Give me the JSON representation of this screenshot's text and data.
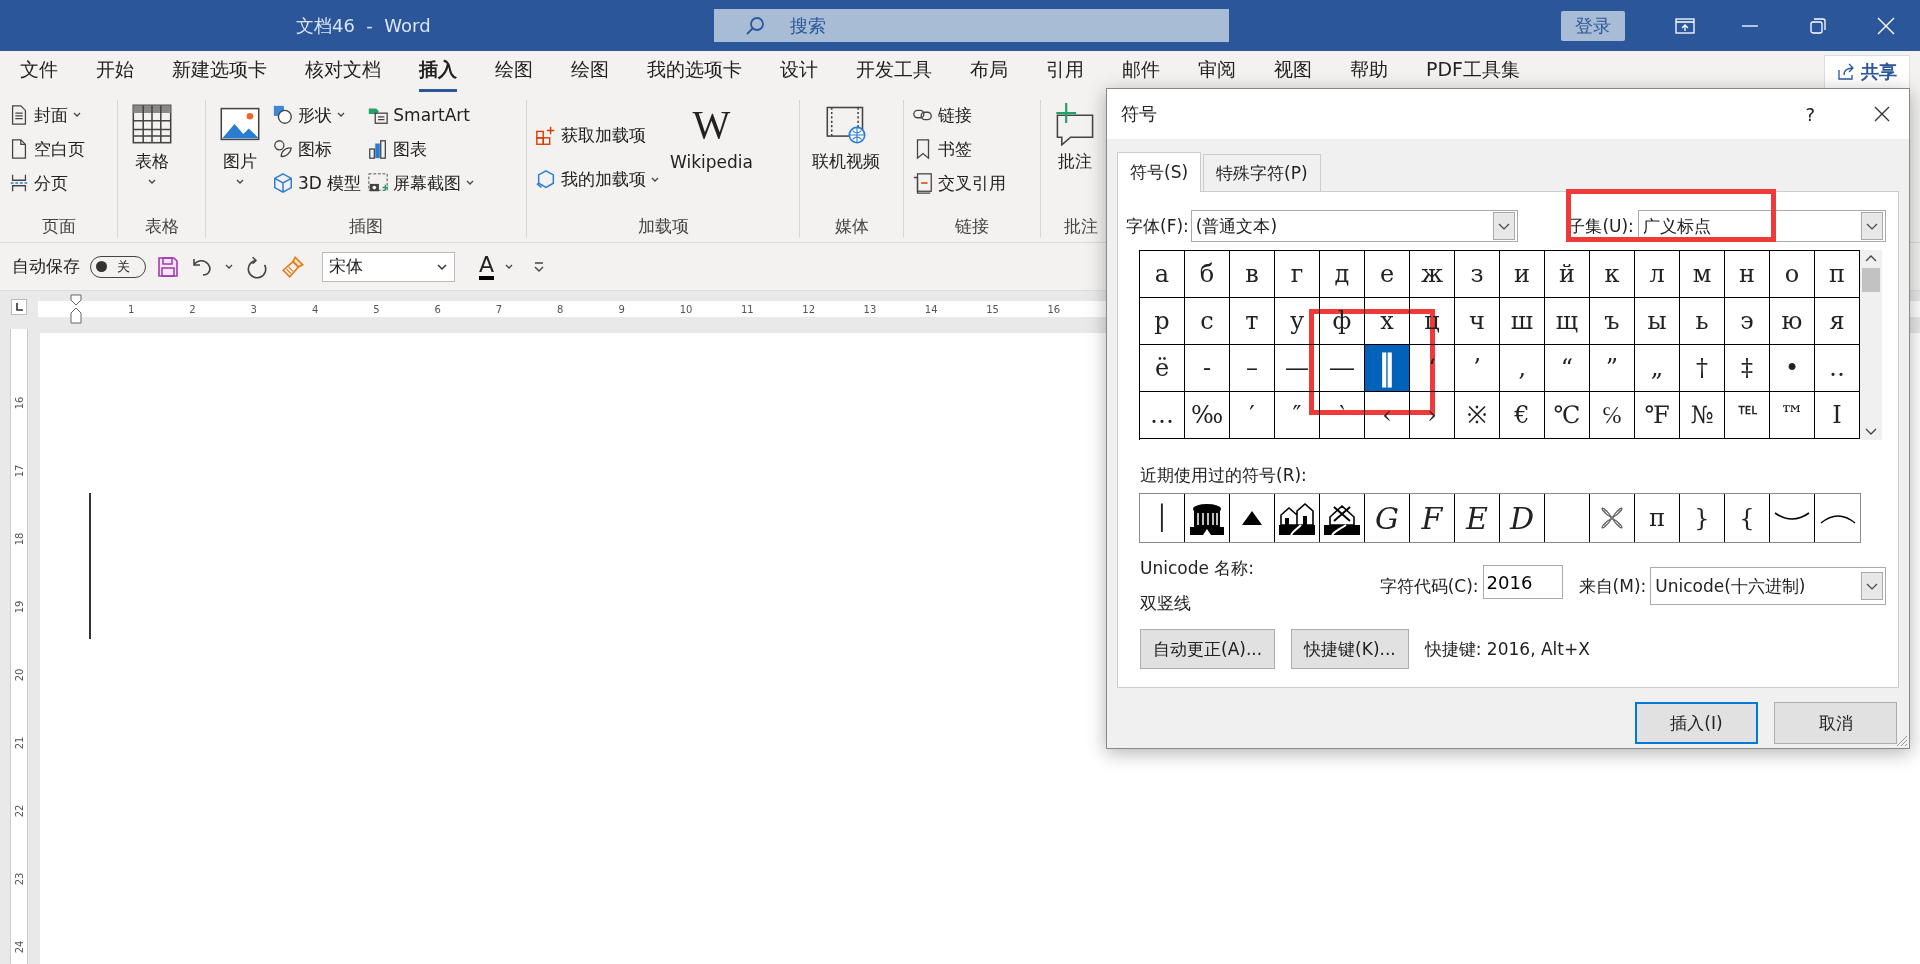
{
  "window": {
    "title": "文档46  -  Word",
    "search_placeholder": "搜索",
    "sign_in": "登录"
  },
  "menu_tabs": [
    {
      "label": "文件",
      "selected": false
    },
    {
      "label": "开始",
      "selected": false
    },
    {
      "label": "新建选项卡",
      "selected": false
    },
    {
      "label": "核对文档",
      "selected": false
    },
    {
      "label": "插入",
      "selected": true
    },
    {
      "label": "绘图",
      "selected": false
    },
    {
      "label": "绘图",
      "selected": false
    },
    {
      "label": "我的选项卡",
      "selected": false
    },
    {
      "label": "设计",
      "selected": false
    },
    {
      "label": "开发工具",
      "selected": false
    },
    {
      "label": "布局",
      "selected": false
    },
    {
      "label": "引用",
      "selected": false
    },
    {
      "label": "邮件",
      "selected": false
    },
    {
      "label": "审阅",
      "selected": false
    },
    {
      "label": "视图",
      "selected": false
    },
    {
      "label": "帮助",
      "selected": false
    },
    {
      "label": "PDF工具集",
      "selected": false
    }
  ],
  "share": "共享",
  "ribbon": {
    "groups": [
      {
        "label": "页面",
        "items": [
          {
            "label": "封面",
            "dropdown": true
          },
          {
            "label": "空白页",
            "dropdown": false
          },
          {
            "label": "分页",
            "dropdown": false
          }
        ]
      },
      {
        "label": "表格",
        "items": [
          {
            "label": "表格",
            "dropdown": true
          }
        ]
      },
      {
        "label": "插图",
        "items": [
          {
            "label": "图片",
            "dropdown": true
          },
          {
            "label": "形状",
            "dropdown": true
          },
          {
            "label": "图标",
            "dropdown": false
          },
          {
            "label": "3D 模型",
            "dropdown": false
          },
          {
            "label": "SmartArt",
            "dropdown": false
          },
          {
            "label": "图表",
            "dropdown": false
          },
          {
            "label": "屏幕截图",
            "dropdown": true
          }
        ]
      },
      {
        "label": "加载项",
        "items": [
          {
            "label": "获取加载项",
            "dropdown": false
          },
          {
            "label": "我的加载项",
            "dropdown": true
          },
          {
            "label": "Wikipedia",
            "dropdown": false,
            "logo_letter": "W"
          }
        ]
      },
      {
        "label": "媒体",
        "items": [
          {
            "label": "联机视频",
            "dropdown": false
          }
        ]
      },
      {
        "label": "链接",
        "items": [
          {
            "label": "链接",
            "dropdown": false
          },
          {
            "label": "书签",
            "dropdown": false
          },
          {
            "label": "交叉引用",
            "dropdown": false
          }
        ]
      },
      {
        "label": "批注",
        "items": [
          {
            "label": "批注",
            "dropdown": false
          }
        ]
      }
    ]
  },
  "quick_access": {
    "autosave_label": "自动保存",
    "autosave_on": false,
    "autosave_state": "关",
    "font": "宋体",
    "font_color_letter": "A"
  },
  "ruler": {
    "numbers": [
      "1",
      "2",
      "3",
      "4",
      "5",
      "6",
      "7",
      "8",
      "9",
      "10",
      "11",
      "12",
      "13",
      "14",
      "15",
      "16"
    ],
    "vertical_numbers": [
      "16",
      "17",
      "18",
      "19",
      "20",
      "21",
      "22",
      "23",
      "24"
    ]
  },
  "dialog": {
    "title": "符号",
    "help": "?",
    "tabs": [
      {
        "label": "符号(S)",
        "selected": true
      },
      {
        "label": "特殊字符(P)",
        "selected": false
      }
    ],
    "font_label": "字体(F):",
    "font_value": "(普通文本)",
    "subset_label": "子集(U):",
    "subset_value": "广义标点",
    "symbols": [
      {
        "char": "а",
        "selected": false
      },
      {
        "char": "б",
        "selected": false
      },
      {
        "char": "в",
        "selected": false
      },
      {
        "char": "г",
        "selected": false
      },
      {
        "char": "д",
        "selected": false
      },
      {
        "char": "е",
        "selected": false
      },
      {
        "char": "ж",
        "selected": false
      },
      {
        "char": "з",
        "selected": false
      },
      {
        "char": "и",
        "selected": false
      },
      {
        "char": "й",
        "selected": false
      },
      {
        "char": "к",
        "selected": false
      },
      {
        "char": "л",
        "selected": false
      },
      {
        "char": "м",
        "selected": false
      },
      {
        "char": "н",
        "selected": false
      },
      {
        "char": "о",
        "selected": false
      },
      {
        "char": "п",
        "selected": false
      },
      {
        "char": "р",
        "selected": false
      },
      {
        "char": "с",
        "selected": false
      },
      {
        "char": "т",
        "selected": false
      },
      {
        "char": "у",
        "selected": false
      },
      {
        "char": "ф",
        "selected": false
      },
      {
        "char": "х",
        "selected": false
      },
      {
        "char": "ц",
        "selected": false
      },
      {
        "char": "ч",
        "selected": false
      },
      {
        "char": "ш",
        "selected": false
      },
      {
        "char": "щ",
        "selected": false
      },
      {
        "char": "ъ",
        "selected": false
      },
      {
        "char": "ы",
        "selected": false
      },
      {
        "char": "ь",
        "selected": false
      },
      {
        "char": "э",
        "selected": false
      },
      {
        "char": "ю",
        "selected": false
      },
      {
        "char": "я",
        "selected": false
      },
      {
        "char": "ё",
        "selected": false
      },
      {
        "char": "‐",
        "selected": false
      },
      {
        "char": "–",
        "selected": false
      },
      {
        "char": "—",
        "selected": false
      },
      {
        "char": "―",
        "selected": false
      },
      {
        "char": "‖",
        "selected": true
      },
      {
        "char": "‘",
        "selected": false
      },
      {
        "char": "’",
        "selected": false
      },
      {
        "char": "‚",
        "selected": false
      },
      {
        "char": "“",
        "selected": false
      },
      {
        "char": "”",
        "selected": false
      },
      {
        "char": "„",
        "selected": false
      },
      {
        "char": "†",
        "selected": false
      },
      {
        "char": "‡",
        "selected": false
      },
      {
        "char": "•",
        "selected": false
      },
      {
        "char": "‥",
        "selected": false
      },
      {
        "char": "…",
        "selected": false
      },
      {
        "char": "‰",
        "selected": false
      },
      {
        "char": "′",
        "selected": false
      },
      {
        "char": "″",
        "selected": false
      },
      {
        "char": "‵",
        "selected": false
      },
      {
        "char": "‹",
        "selected": false
      },
      {
        "char": "›",
        "selected": false
      },
      {
        "char": "※",
        "selected": false
      },
      {
        "char": "€",
        "selected": false
      },
      {
        "char": "℃",
        "selected": false
      },
      {
        "char": "℅",
        "selected": false
      },
      {
        "char": "℉",
        "selected": false
      },
      {
        "char": "№",
        "selected": false
      },
      {
        "char": "℡",
        "selected": false
      },
      {
        "char": "™",
        "selected": false
      },
      {
        "char": "Ⅰ",
        "selected": false
      }
    ],
    "recent_label": "近期使用过的符号(R):",
    "recent": [
      {
        "kind": "char",
        "char": "│"
      },
      {
        "kind": "stadium"
      },
      {
        "kind": "triangle"
      },
      {
        "kind": "house"
      },
      {
        "kind": "cottage"
      },
      {
        "kind": "script",
        "char": "G"
      },
      {
        "kind": "script",
        "char": "F"
      },
      {
        "kind": "script",
        "char": "E"
      },
      {
        "kind": "script",
        "char": "D"
      },
      {
        "kind": "blank"
      },
      {
        "kind": "flower"
      },
      {
        "kind": "char",
        "char": "π"
      },
      {
        "kind": "char",
        "char": "}"
      },
      {
        "kind": "char",
        "char": "{"
      },
      {
        "kind": "arc-down"
      },
      {
        "kind": "arc-up"
      }
    ],
    "unicode_name_label": "Unicode 名称:",
    "unicode_name": "双竖线",
    "code_label": "字符代码(C):",
    "code_value": "2016",
    "from_label": "来自(M):",
    "from_value": "Unicode(十六进制)",
    "autocorrect_button": "自动更正(A)...",
    "shortcut_button": "快捷键(K)...",
    "shortcut_text": "快捷键: 2016, Alt+X",
    "buttons": [
      {
        "label": "插入(I)",
        "default": true
      },
      {
        "label": "取消",
        "default": false
      }
    ]
  }
}
